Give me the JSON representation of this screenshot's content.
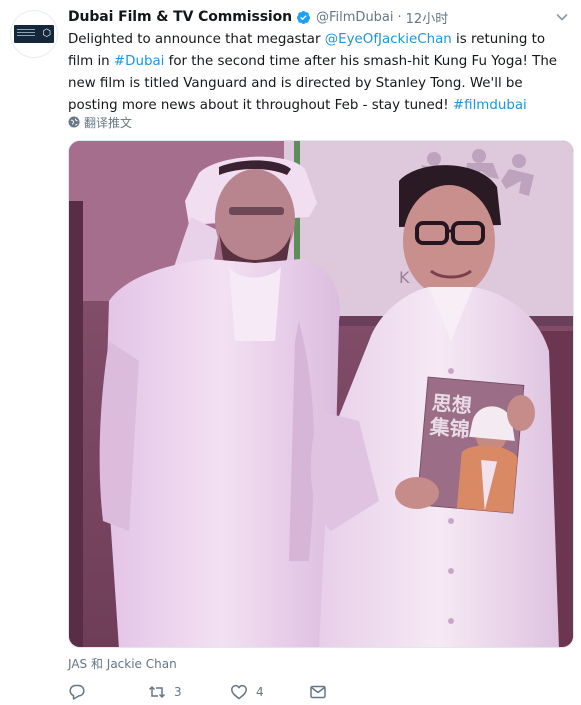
{
  "tweet": {
    "author_name": "Dubai Film & TV Commission",
    "handle": "@FilmDubai",
    "separator": "·",
    "timestamp": "12小时",
    "text_parts": {
      "p1": "Delighted to announce that megastar ",
      "mention": "@EyeOfJackieChan",
      "p2": " is retuning to film in ",
      "hashtag1": "#Dubai",
      "p3": " for the second time after his smash-hit Kung Fu Yoga! The new film is titled Vanguard and is directed by Stanley Tong. We'll be posting more news about it throughout Feb - stay tuned! ",
      "hashtag2": "#filmdubai"
    },
    "translate_label": "翻译推文",
    "photo": {
      "backdrop_text": "K    OGA",
      "book_title_line1": "思想",
      "book_title_line2": "集锦"
    },
    "caption": "JAS 和 Jackie Chan",
    "actions": {
      "reply_count": "",
      "retweet_count": "3",
      "like_count": "4"
    }
  },
  "colors": {
    "link": "#1b95e0",
    "secondary_text": "#657786",
    "primary_text": "#14171a",
    "verified": "#1da1f2",
    "logo_bg": "#15273a"
  },
  "icons": {
    "verified": "verified-badge-icon",
    "chevron": "chevron-down-icon",
    "translate": "globe-icon",
    "reply": "reply-icon",
    "retweet": "retweet-icon",
    "like": "heart-icon",
    "dm": "envelope-icon"
  }
}
